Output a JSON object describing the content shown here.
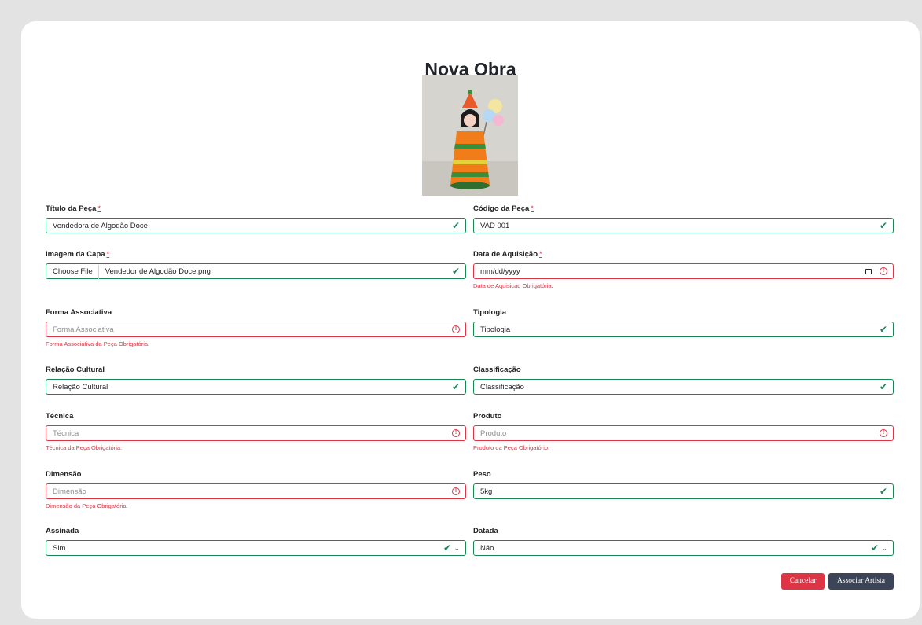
{
  "page": {
    "title": "Nova Obra"
  },
  "colors": {
    "valid": "#198754",
    "invalid": "#dc3545",
    "primary": "#3c4557"
  },
  "fields": {
    "titulo": {
      "label": "Título da Peça",
      "required": "*",
      "value": "Vendedora de Algodão Doce"
    },
    "codigo": {
      "label": "Código da Peça",
      "required": "*",
      "value": "VAD 001"
    },
    "imagem": {
      "label": "Imagem da Capa",
      "required": "*",
      "button": "Choose File",
      "value": "Vendedor de Algodão Doce.png"
    },
    "data_aquisicao": {
      "label": "Data de Aquisição",
      "required": "*",
      "placeholder": "mm/dd/yyyy",
      "error": "Data de Aquisicao Obrigatória."
    },
    "forma": {
      "label": "Forma Associativa",
      "placeholder": "Forma Associativa",
      "error": "Forma Associativa da Peça Obrigatória."
    },
    "tipologia": {
      "label": "Tipologia",
      "value": "Tipologia"
    },
    "relacao": {
      "label": "Relação Cultural",
      "value": "Relação Cultural"
    },
    "classificacao": {
      "label": "Classificação",
      "value": "Classificação"
    },
    "tecnica": {
      "label": "Técnica",
      "placeholder": "Técnica",
      "error": "Técnica da Peça Obrigatória."
    },
    "produto": {
      "label": "Produto",
      "placeholder": "Produto",
      "error": "Produto da Peça Obrigatório."
    },
    "dimensao": {
      "label": "Dimensão",
      "placeholder": "Dimensão",
      "error": "Dimensão da Peça Obrigatória."
    },
    "peso": {
      "label": "Peso",
      "value": "5kg"
    },
    "assinada": {
      "label": "Assinada",
      "value": "Sim"
    },
    "datada": {
      "label": "Datada",
      "value": "Não"
    }
  },
  "icons": {
    "valid": "✔",
    "invalid": "!",
    "chevron": "⌄"
  },
  "buttons": {
    "cancel": "Cancelar",
    "associate": "Associar Artista"
  }
}
